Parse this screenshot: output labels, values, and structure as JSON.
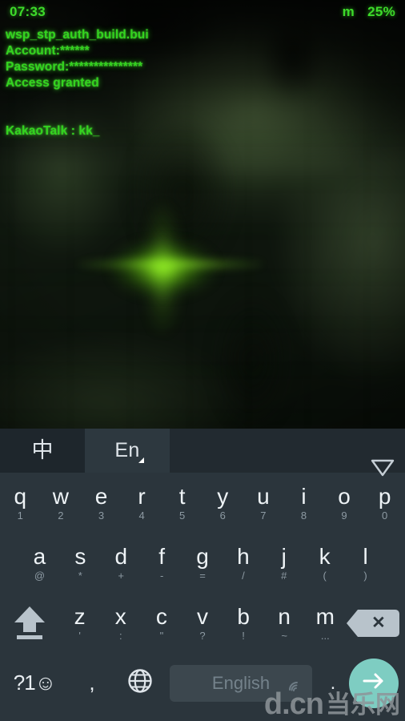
{
  "status_bar": {
    "time": "07:33",
    "carrier_or_signal": "m",
    "battery": "25%",
    "text_color": "#3ddb2a"
  },
  "terminal": {
    "color": "#33d41f",
    "lines": [
      "wsp_stp_auth_build.bui",
      "Account:******",
      "Password:***************",
      "Access granted"
    ],
    "input_line": "KakaoTalk : kk_"
  },
  "keyboard": {
    "background": "#2b353c",
    "toolbar": {
      "tab_chinese": "中",
      "tab_english": "En",
      "hide_keyboard_icon": "triangle-down-icon"
    },
    "rows": [
      {
        "id": "row1",
        "keys": [
          {
            "main": "q",
            "sub": "1"
          },
          {
            "main": "w",
            "sub": "2"
          },
          {
            "main": "e",
            "sub": "3"
          },
          {
            "main": "r",
            "sub": "4"
          },
          {
            "main": "t",
            "sub": "5"
          },
          {
            "main": "y",
            "sub": "6"
          },
          {
            "main": "u",
            "sub": "7"
          },
          {
            "main": "i",
            "sub": "8"
          },
          {
            "main": "o",
            "sub": "9"
          },
          {
            "main": "p",
            "sub": "0"
          }
        ]
      },
      {
        "id": "row2",
        "keys": [
          {
            "main": "a",
            "sub": "@"
          },
          {
            "main": "s",
            "sub": "*"
          },
          {
            "main": "d",
            "sub": "+"
          },
          {
            "main": "f",
            "sub": "-"
          },
          {
            "main": "g",
            "sub": "="
          },
          {
            "main": "h",
            "sub": "/"
          },
          {
            "main": "j",
            "sub": "#"
          },
          {
            "main": "k",
            "sub": "("
          },
          {
            "main": "l",
            "sub": ")"
          }
        ]
      },
      {
        "id": "row3",
        "keys": [
          {
            "main": "z",
            "sub": "'"
          },
          {
            "main": "x",
            "sub": ":"
          },
          {
            "main": "c",
            "sub": "\""
          },
          {
            "main": "v",
            "sub": "?"
          },
          {
            "main": "b",
            "sub": "!"
          },
          {
            "main": "n",
            "sub": "~"
          },
          {
            "main": "m",
            "sub": "..."
          }
        ],
        "shift_icon": "shift-arrow-icon",
        "backspace_icon": "backspace-icon"
      }
    ],
    "bottom_row": {
      "symbols_key": "?1☺",
      "comma_key": ",",
      "globe_icon": "globe-icon",
      "spacebar_label": "English",
      "spacebar_signal_icon": "signal-icon",
      "period_key": ".",
      "enter_icon": "arrow-right-icon",
      "enter_color": "#7ecdc2"
    }
  },
  "watermark": {
    "latin": "d.cn",
    "cjk": "当乐网"
  }
}
